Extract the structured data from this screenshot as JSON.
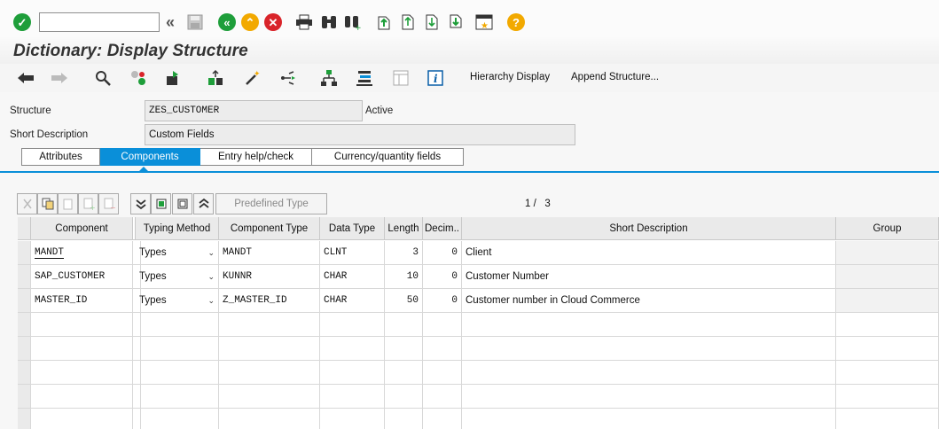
{
  "command_field": {
    "value": ""
  },
  "page_title": "Dictionary: Display Structure",
  "app_toolbar": {
    "hierarchy_display": "Hierarchy Display",
    "append_structure": "Append Structure..."
  },
  "header": {
    "structure_label": "Structure",
    "structure_value": "ZES_CUSTOMER",
    "status": "Active",
    "short_desc_label": "Short Description",
    "short_desc_value": "Custom Fields"
  },
  "tabs": [
    {
      "label": "Attributes"
    },
    {
      "label": "Components"
    },
    {
      "label": "Entry help/check"
    },
    {
      "label": "Currency/quantity fields"
    }
  ],
  "table_toolbar": {
    "predefined_type": "Predefined Type",
    "page_current": "1",
    "page_sep": "/",
    "page_total": "3"
  },
  "table": {
    "columns": [
      "Component",
      "Typing Method",
      "Component Type",
      "Data Type",
      "Length",
      "Decim..",
      "Short Description",
      "Group"
    ],
    "rows": [
      {
        "component": "MANDT",
        "typing": "Types",
        "comp_type": "MANDT",
        "data_type": "CLNT",
        "length": "3",
        "decimals": "0",
        "desc": "Client",
        "group": ""
      },
      {
        "component": "SAP_CUSTOMER",
        "typing": "Types",
        "comp_type": "KUNNR",
        "data_type": "CHAR",
        "length": "10",
        "decimals": "0",
        "desc": "Customer Number",
        "group": ""
      },
      {
        "component": "MASTER_ID",
        "typing": "Types",
        "comp_type": "Z_MASTER_ID",
        "data_type": "CHAR",
        "length": "50",
        "decimals": "0",
        "desc": "Customer number in Cloud Commerce",
        "group": ""
      }
    ]
  },
  "colors": {
    "accent": "#0a8fd9",
    "ok_green": "#1e9e3a",
    "cancel_red": "#d9242a",
    "help_orange": "#f2a900"
  }
}
